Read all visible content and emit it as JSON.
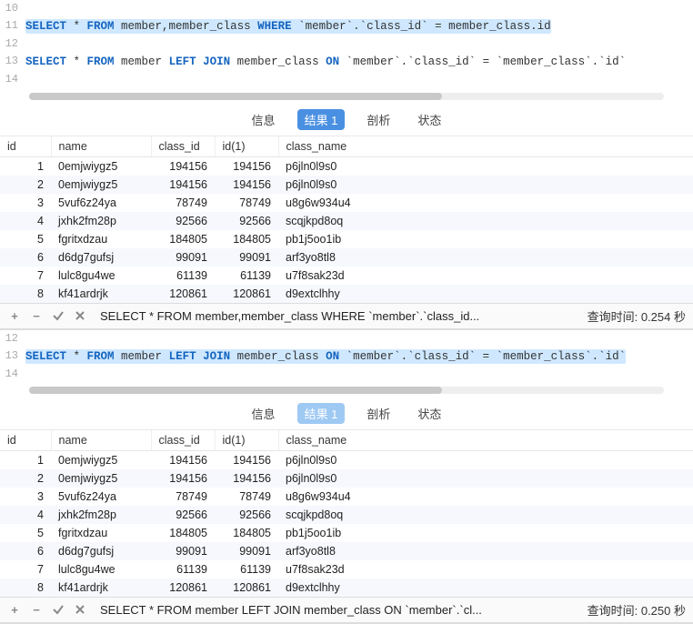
{
  "panel1": {
    "lines": [
      {
        "n": "10",
        "html": ""
      },
      {
        "n": "11",
        "sel": true,
        "tokens": [
          {
            "t": "SELECT",
            "c": "kw"
          },
          {
            "t": " * ",
            "c": "op"
          },
          {
            "t": "FROM",
            "c": "kw"
          },
          {
            "t": " member,member_class ",
            "c": "ident"
          },
          {
            "t": "WHERE",
            "c": "kw"
          },
          {
            "t": " `member`.`class_id` = member_class.id",
            "c": "ident"
          }
        ]
      },
      {
        "n": "12",
        "html": ""
      },
      {
        "n": "13",
        "tokens": [
          {
            "t": "SELECT",
            "c": "kw"
          },
          {
            "t": " * ",
            "c": "op"
          },
          {
            "t": "FROM",
            "c": "kw"
          },
          {
            "t": " member ",
            "c": "ident"
          },
          {
            "t": "LEFT JOIN",
            "c": "kw"
          },
          {
            "t": " member_class ",
            "c": "ident"
          },
          {
            "t": "ON",
            "c": "kw"
          },
          {
            "t": " `member`.`class_id` = `member_class`.`id`",
            "c": "ident"
          }
        ]
      },
      {
        "n": "14",
        "html": ""
      }
    ],
    "tabs": {
      "info": "信息",
      "result": "结果 1",
      "profile": "剖析",
      "status": "状态"
    },
    "columns": [
      "id",
      "name",
      "class_id",
      "id(1)",
      "class_name"
    ],
    "rows": [
      [
        1,
        "0emjwiygz5",
        194156,
        194156,
        "p6jln0l9s0"
      ],
      [
        2,
        "0emjwiygz5",
        194156,
        194156,
        "p6jln0l9s0"
      ],
      [
        3,
        "5vuf6z24ya",
        78749,
        78749,
        "u8g6w934u4"
      ],
      [
        4,
        "jxhk2fm28p",
        92566,
        92566,
        "scqjkpd8oq"
      ],
      [
        5,
        "fgritxdzau",
        184805,
        184805,
        "pb1j5oo1ib"
      ],
      [
        6,
        "d6dg7gufsj",
        99091,
        99091,
        "arf3yo8tl8"
      ],
      [
        7,
        "lulc8gu4we",
        61139,
        61139,
        "u7f8sak23d"
      ],
      [
        8,
        "kf41ardrjk",
        120861,
        120861,
        "d9extclhhy"
      ]
    ],
    "status_sql": "SELECT * FROM member,member_class WHERE `member`.`class_id...",
    "query_time_label": "查询时间:",
    "query_time_value": "0.254 秒"
  },
  "panel2": {
    "lines": [
      {
        "n": "12",
        "html": ""
      },
      {
        "n": "13",
        "sel": true,
        "tokens": [
          {
            "t": "SELECT",
            "c": "kw"
          },
          {
            "t": " * ",
            "c": "op"
          },
          {
            "t": "FROM",
            "c": "kw"
          },
          {
            "t": " member ",
            "c": "ident"
          },
          {
            "t": "LEFT JOIN",
            "c": "kw"
          },
          {
            "t": " member_class ",
            "c": "ident"
          },
          {
            "t": "ON",
            "c": "kw"
          },
          {
            "t": " `member`.`class_id` = `member_class`.`id`",
            "c": "ident"
          }
        ]
      },
      {
        "n": "14",
        "html": ""
      }
    ],
    "tabs": {
      "info": "信息",
      "result": "结果 1",
      "profile": "剖析",
      "status": "状态"
    },
    "columns": [
      "id",
      "name",
      "class_id",
      "id(1)",
      "class_name"
    ],
    "rows": [
      [
        1,
        "0emjwiygz5",
        194156,
        194156,
        "p6jln0l9s0"
      ],
      [
        2,
        "0emjwiygz5",
        194156,
        194156,
        "p6jln0l9s0"
      ],
      [
        3,
        "5vuf6z24ya",
        78749,
        78749,
        "u8g6w934u4"
      ],
      [
        4,
        "jxhk2fm28p",
        92566,
        92566,
        "scqjkpd8oq"
      ],
      [
        5,
        "fgritxdzau",
        184805,
        184805,
        "pb1j5oo1ib"
      ],
      [
        6,
        "d6dg7gufsj",
        99091,
        99091,
        "arf3yo8tl8"
      ],
      [
        7,
        "lulc8gu4we",
        61139,
        61139,
        "u7f8sak23d"
      ],
      [
        8,
        "kf41ardrjk",
        120861,
        120861,
        "d9extclhhy"
      ]
    ],
    "status_sql": "SELECT * FROM member LEFT JOIN member_class ON `member`.`cl...",
    "query_time_label": "查询时间:",
    "query_time_value": "0.250 秒"
  }
}
